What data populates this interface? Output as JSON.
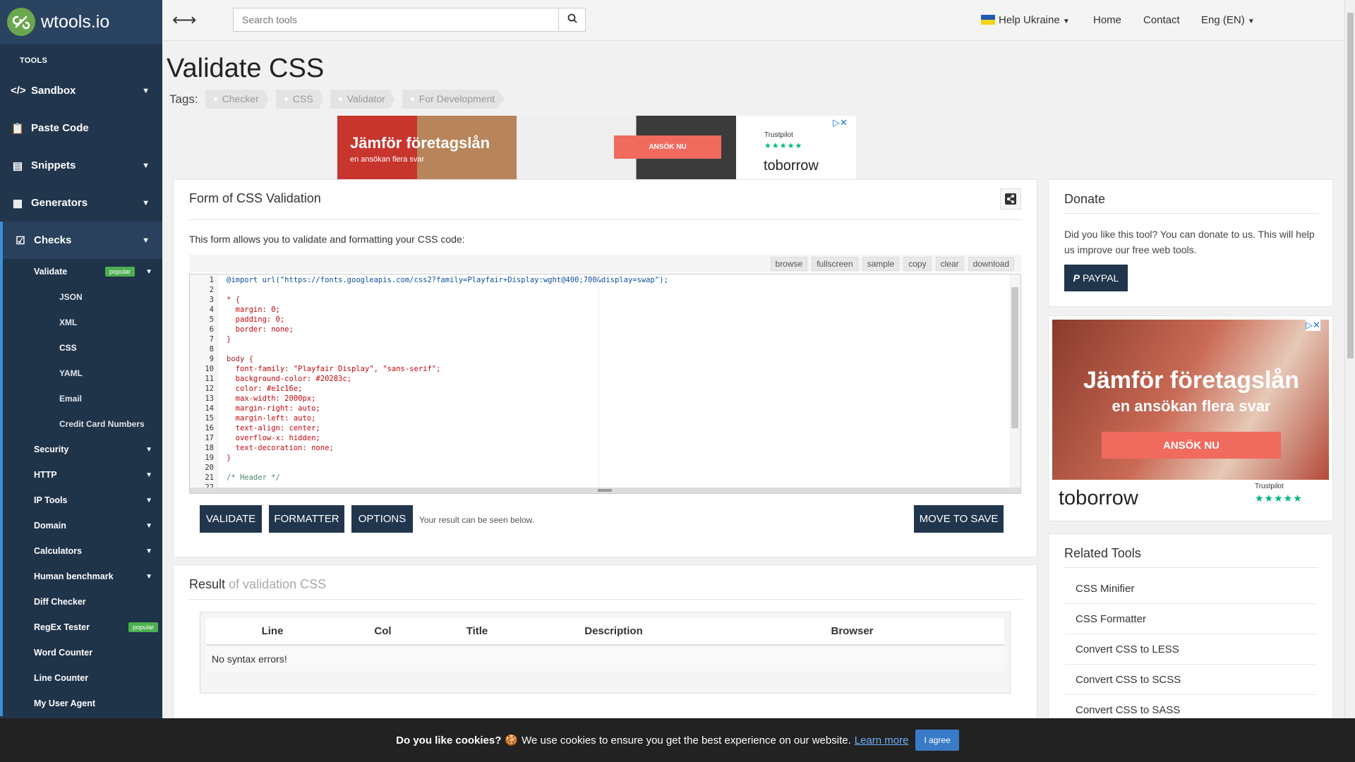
{
  "brand": {
    "name": "wtools.io"
  },
  "sidebar": {
    "section_label": "TOOLS",
    "items": [
      {
        "label": "Sandbox"
      },
      {
        "label": "Paste Code"
      },
      {
        "label": "Snippets"
      },
      {
        "label": "Generators"
      },
      {
        "label": "Checks"
      }
    ],
    "checks": {
      "validate": {
        "label": "Validate",
        "badge": "popular"
      },
      "validate_children": [
        "JSON",
        "XML",
        "CSS",
        "YAML",
        "Email",
        "Credit Card Numbers"
      ],
      "items": [
        {
          "label": "Security"
        },
        {
          "label": "HTTP"
        },
        {
          "label": "IP Tools"
        },
        {
          "label": "Domain"
        },
        {
          "label": "Calculators"
        },
        {
          "label": "Human benchmark"
        },
        {
          "label": "Diff Checker"
        },
        {
          "label": "RegEx Tester",
          "badge": "popular"
        },
        {
          "label": "Word Counter"
        },
        {
          "label": "Line Counter"
        },
        {
          "label": "My User Agent"
        }
      ]
    }
  },
  "topbar": {
    "search_placeholder": "Search tools",
    "help": "Help Ukraine",
    "home": "Home",
    "contact": "Contact",
    "lang": "Eng (EN)"
  },
  "page": {
    "title": "Validate CSS",
    "tags_label": "Tags:",
    "tags": [
      "Checker",
      "CSS",
      "Validator",
      "For Development"
    ]
  },
  "ad_top": {
    "headline": "Jämför företagslån",
    "sub": "en ansökan flera svar",
    "cta": "ANSÖK NU",
    "trust": "Trustpilot",
    "brand": "toborrow"
  },
  "form": {
    "title": "Form of CSS Validation",
    "intro": "This form allows you to validate and formatting your CSS code:",
    "toolbar": [
      "browse",
      "fullscreen",
      "sample",
      "copy",
      "clear",
      "download"
    ],
    "validate": "VALIDATE",
    "formatter": "FORMATTER",
    "options": "OPTIONS",
    "hint": "Your result can be seen below.",
    "move": "MOVE TO SAVE"
  },
  "code_lines": [
    "@import url(\"https://fonts.googleapis.com/css2?family=Playfair+Display:wght@400;700&display=swap\");",
    "",
    "* {",
    "  margin: 0;",
    "  padding: 0;",
    "  border: none;",
    "}",
    "",
    "body {",
    "  font-family: \"Playfair Display\", \"sans-serif\";",
    "  background-color: #20283c;",
    "  color: #e1c16e;",
    "  max-width: 2000px;",
    "  margin-right: auto;",
    "  margin-left: auto;",
    "  text-align: center;",
    "  overflow-x: hidden;",
    "  text-decoration: none;",
    "}",
    "",
    "/* Header */",
    ""
  ],
  "result": {
    "title": "Result",
    "subtitle": "of validation CSS",
    "columns": [
      "Line",
      "Col",
      "Title",
      "Description",
      "Browser"
    ],
    "message": "No syntax errors!"
  },
  "donate": {
    "title": "Donate",
    "text": "Did you like this tool? You can donate to us. This will help us improve our free web tools.",
    "button": "PAYPAL"
  },
  "ad_side": {
    "headline": "Jämför företagslån",
    "sub": "en ansökan flera svar",
    "cta": "ANSÖK NU",
    "trust": "Trustpilot",
    "brand": "toborrow"
  },
  "related": {
    "title": "Related Tools",
    "items": [
      "CSS Minifier",
      "CSS Formatter",
      "Convert CSS to LESS",
      "Convert CSS to SCSS",
      "Convert CSS to SASS"
    ]
  },
  "cookie": {
    "bold": "Do you like cookies?",
    "text": "We use cookies to ensure you get the best experience on our website.",
    "link": "Learn more",
    "button": "I agree"
  },
  "colors": {
    "sidebar": "#21364d",
    "accent": "#3a8fd6",
    "badge": "#4caf50"
  }
}
